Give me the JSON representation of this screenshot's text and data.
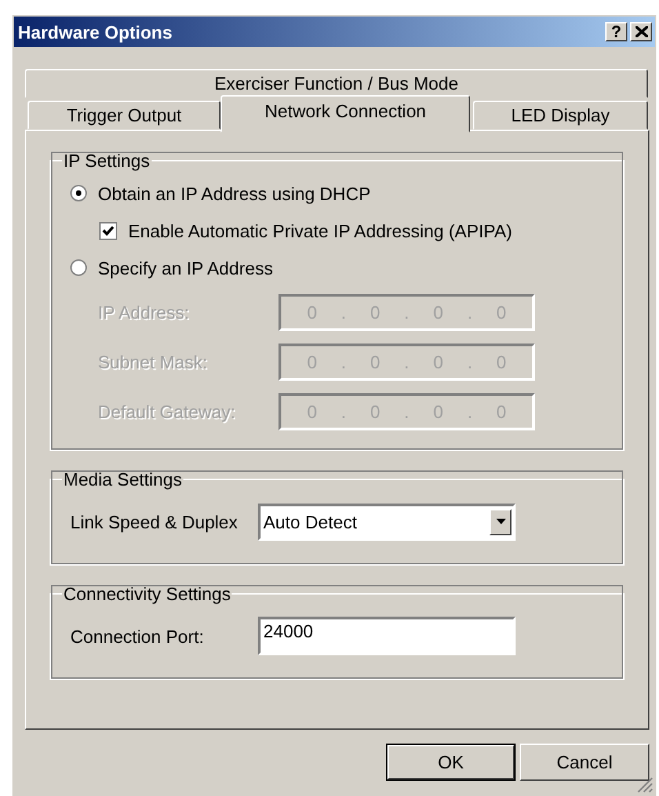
{
  "window": {
    "title": "Hardware Options",
    "help": "?"
  },
  "tab_rows": [
    [
      {
        "label": "Exerciser Function / Bus Mode",
        "selected": false
      }
    ],
    [
      {
        "label": "Trigger Output",
        "selected": false
      },
      {
        "label": "Network Connection",
        "selected": true
      },
      {
        "label": "LED Display",
        "selected": false
      }
    ]
  ],
  "ip_settings": {
    "title": "IP Settings",
    "options": [
      {
        "label": "Obtain an IP Address using DHCP",
        "selected": true,
        "children": [
          {
            "label": "Enable Automatic Private IP Addressing (APIPA)",
            "checked": true
          }
        ]
      },
      {
        "label": "Specify an IP Address",
        "selected": false,
        "fields": [
          {
            "label": "IP Address:",
            "octets": [
              "0",
              "0",
              "0",
              "0"
            ],
            "separator": ".",
            "disabled": true
          },
          {
            "label": "Subnet Mask:",
            "octets": [
              "0",
              "0",
              "0",
              "0"
            ],
            "separator": ".",
            "disabled": true
          },
          {
            "label": "Default Gateway:",
            "octets": [
              "0",
              "0",
              "0",
              "0"
            ],
            "separator": ".",
            "disabled": true
          }
        ]
      }
    ]
  },
  "groups": [
    {
      "title": "Media Settings",
      "fields": [
        {
          "label": "Link Speed & Duplex",
          "value": "Auto Detect",
          "kind": "dropdown"
        }
      ]
    },
    {
      "title": "Connectivity Settings",
      "fields": [
        {
          "label": "Connection Port:",
          "value": "24000",
          "kind": "text"
        }
      ]
    }
  ],
  "buttons": [
    {
      "label": "OK",
      "default": true
    },
    {
      "label": "Cancel",
      "default": false
    }
  ]
}
